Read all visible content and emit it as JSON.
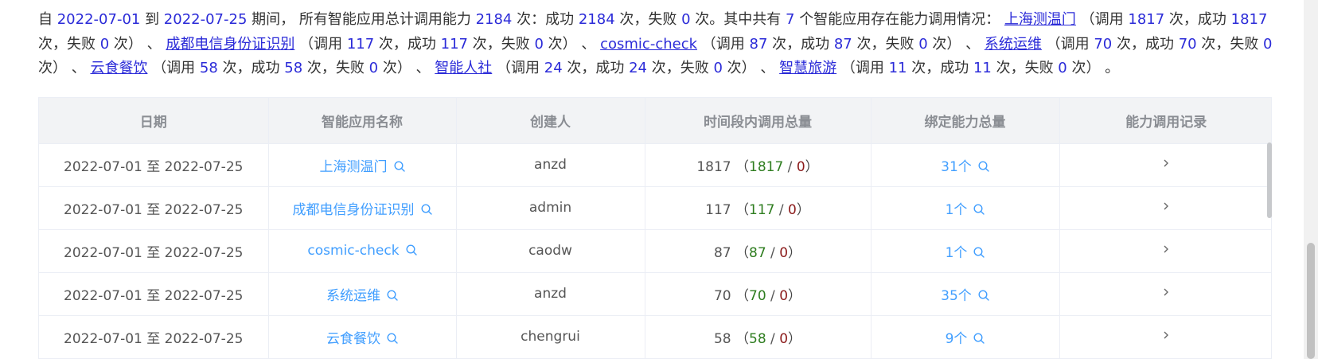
{
  "summary": {
    "p_from": "自 ",
    "start_date": "2022-07-01",
    "p_to": " 到 ",
    "end_date": "2022-07-25",
    "p_period": " 期间， 所有智能应用总计调用能力 ",
    "total_calls": "2184",
    "p_times_success": " 次：成功 ",
    "total_success": "2184",
    "p_times_fail": " 次，失败 ",
    "total_fail": "0",
    "p_times_end": " 次。其中共有 ",
    "app_count": "7",
    "p_apps": " 个智能应用存在能力调用情况： ",
    "call_open": "（调用 ",
    "succ_open": " 次，成功 ",
    "fail_open": " 次，失败 ",
    "close": " 次）",
    "sep": " 、 ",
    "end": " 。",
    "apps": [
      {
        "name": "上海测温门",
        "calls": "1817",
        "success": "1817",
        "fail": "0"
      },
      {
        "name": "成都电信身份证识别",
        "calls": "117",
        "success": "117",
        "fail": "0"
      },
      {
        "name": "cosmic-check",
        "calls": "87",
        "success": "87",
        "fail": "0"
      },
      {
        "name": "系统运维",
        "calls": "70",
        "success": "70",
        "fail": "0"
      },
      {
        "name": "云食餐饮",
        "calls": "58",
        "success": "58",
        "fail": "0"
      },
      {
        "name": "智能人社",
        "calls": "24",
        "success": "24",
        "fail": "0"
      },
      {
        "name": "智慧旅游",
        "calls": "11",
        "success": "11",
        "fail": "0"
      }
    ]
  },
  "table": {
    "headers": [
      "日期",
      "智能应用名称",
      "创建人",
      "时间段内调用总量",
      "绑定能力总量",
      "能力调用记录"
    ],
    "rows": [
      {
        "date": "2022-07-01 至 2022-07-25",
        "app": "上海测温门",
        "creator": "anzd",
        "total": "1817",
        "success": "1817",
        "fail": "0",
        "bound": "31个"
      },
      {
        "date": "2022-07-01 至 2022-07-25",
        "app": "成都电信身份证识别",
        "creator": "admin",
        "total": "117",
        "success": "117",
        "fail": "0",
        "bound": "1个"
      },
      {
        "date": "2022-07-01 至 2022-07-25",
        "app": "cosmic-check",
        "creator": "caodw",
        "total": "87",
        "success": "87",
        "fail": "0",
        "bound": "1个"
      },
      {
        "date": "2022-07-01 至 2022-07-25",
        "app": "系统运维",
        "creator": "anzd",
        "total": "70",
        "success": "70",
        "fail": "0",
        "bound": "35个"
      },
      {
        "date": "2022-07-01 至 2022-07-25",
        "app": "云食餐饮",
        "creator": "chengrui",
        "total": "58",
        "success": "58",
        "fail": "0",
        "bound": "9个"
      }
    ],
    "paren_open": "（",
    "slash": " / ",
    "paren_close": "）"
  },
  "colors": {
    "link": "#409eff",
    "summary_number": "#2b2bd8",
    "success": "#2e7d1f",
    "fail": "#8b1a1a",
    "header_bg": "#f2f3f5"
  },
  "icons": {
    "search": "search-icon",
    "row_action": "chevron-right-icon"
  }
}
